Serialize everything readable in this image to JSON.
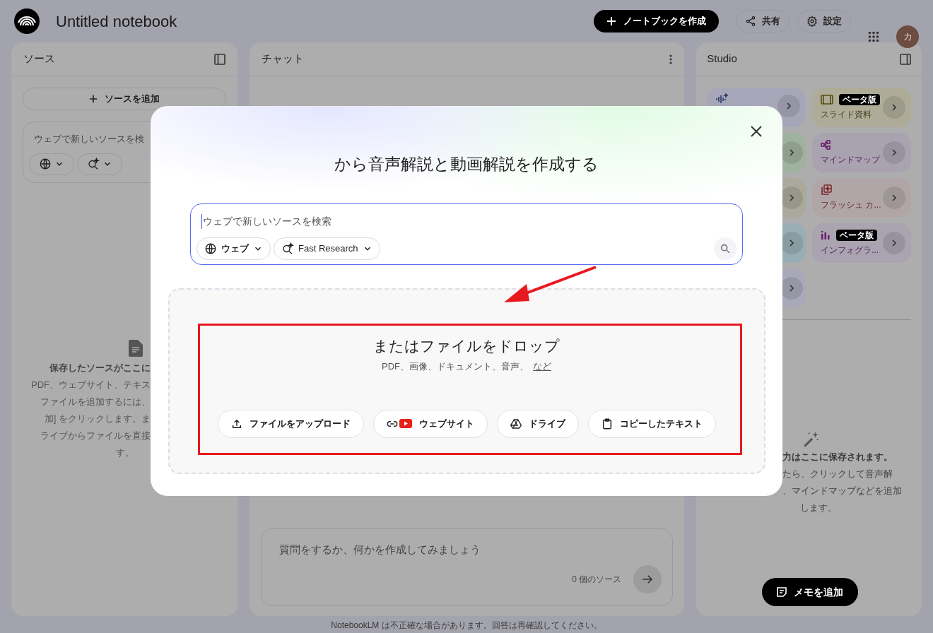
{
  "app": {
    "title": "Untitled notebook",
    "create_button": "ノートブックを作成",
    "share_button": "共有",
    "settings_button": "設定",
    "avatar": "カ"
  },
  "sources": {
    "title": "ソース",
    "add_button": "ソースを追加",
    "search_placeholder": "ウェブで新しいソースを検",
    "empty_title": "保存したソースがここに",
    "empty_lines": [
      "PDF、ウェブサイト、テキス",
      "ファイルを追加するには、",
      "加] をクリックします。ま",
      "ライブからファイルを直接"
    ],
    "empty_tail": "す。"
  },
  "chat": {
    "title": "チャット",
    "input_placeholder": "質問をするか、何かを作成してみましょう",
    "source_count": "0 個のソース"
  },
  "studio": {
    "title": "Studio",
    "left_cards": [
      {
        "kind": "audio",
        "color": "#a6a6b8"
      },
      {
        "kind": "plain",
        "color": "#9fb29f"
      },
      {
        "kind": "plain",
        "color": "#aaa99b"
      },
      {
        "kind": "plain",
        "color": "#98aeb5"
      },
      {
        "kind": "plain",
        "color": "#a9a8b8"
      }
    ],
    "right_cards": [
      {
        "kind": "slides",
        "label": "スライド資料",
        "badge": "ベータ版",
        "color": "#aeac98"
      },
      {
        "kind": "mindmap",
        "label": "マインドマップ",
        "color": "#a9a3b0"
      },
      {
        "kind": "flashcards",
        "label": "フラッシュ カ...",
        "color": "#b0a6a8"
      },
      {
        "kind": "infographic",
        "label": "インフォグラ...",
        "badge": "ベータ版",
        "color": "#aaa3b0"
      }
    ],
    "empty_lines": [
      "力はここに保存されます。",
      "たら、クリックして音声解",
      "、マインドマップなどを追加",
      "します。"
    ],
    "note_button": "メモを追加"
  },
  "footer": "NotebookLM は不正確な場合があります。回答は再確認してください。",
  "dialog": {
    "title": "から音声解説と動画解説を作成する",
    "search_placeholder": "ウェブで新しいソースを検索",
    "source_menu": "ウェブ",
    "mode_menu": "Fast Research",
    "drop_title": "またはファイルをドロップ",
    "drop_hint": "PDF、画像、ドキュメント、音声、",
    "drop_link": "など",
    "buttons": [
      {
        "kind": "upload",
        "label": "ファイルをアップロード"
      },
      {
        "kind": "website",
        "label": "ウェブサイト"
      },
      {
        "kind": "drive",
        "label": "ドライブ"
      },
      {
        "kind": "paste",
        "label": "コピーしたテキスト"
      }
    ]
  }
}
